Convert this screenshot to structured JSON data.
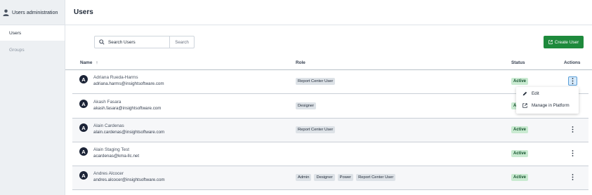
{
  "sidebar": {
    "header": "Users administration",
    "items": [
      {
        "label": "Users"
      },
      {
        "label": "Groups"
      }
    ]
  },
  "page": {
    "title": "Users"
  },
  "search": {
    "placeholder": "Search Users",
    "button_label": "Search"
  },
  "toolbar": {
    "create_label": "Create User",
    "accent_color": "#1e8a3c"
  },
  "table": {
    "columns": {
      "name": "Name",
      "role": "Role",
      "status": "Status",
      "actions": "Actions"
    },
    "sort_indicator": "↑",
    "rows": [
      {
        "initial": "A",
        "name": "Adriana Rueda-Harms",
        "email": "adriana.harms@insightsoftware.com",
        "roles": [
          "Report Center User"
        ],
        "status": "Active"
      },
      {
        "initial": "A",
        "name": "Akash Fasara",
        "email": "akash.fasara@insightsoftware.com",
        "roles": [
          "Designer"
        ],
        "status": "Active"
      },
      {
        "initial": "A",
        "name": "Alain Cardenas",
        "email": "alain.cardenas@insightsoftware.com",
        "roles": [
          "Report Center User"
        ],
        "status": "Active"
      },
      {
        "initial": "A",
        "name": "Alain Staging Test",
        "email": "acardenas@kma-llc.net",
        "roles": [],
        "status": "Active"
      },
      {
        "initial": "A",
        "name": "Andres Alcocer",
        "email": "andres.alcocer@insightsoftware.com",
        "roles": [
          "Admin",
          "Designer",
          "Power",
          "Report Center User"
        ],
        "status": "Active"
      }
    ]
  },
  "actions_menu": {
    "edit_label": "Edit",
    "manage_label": "Manage in Platform"
  },
  "colors": {
    "status_active_bg": "#c9ead1",
    "avatar_bg": "#1c2437",
    "sidebar_bg": "#edf0f3"
  }
}
